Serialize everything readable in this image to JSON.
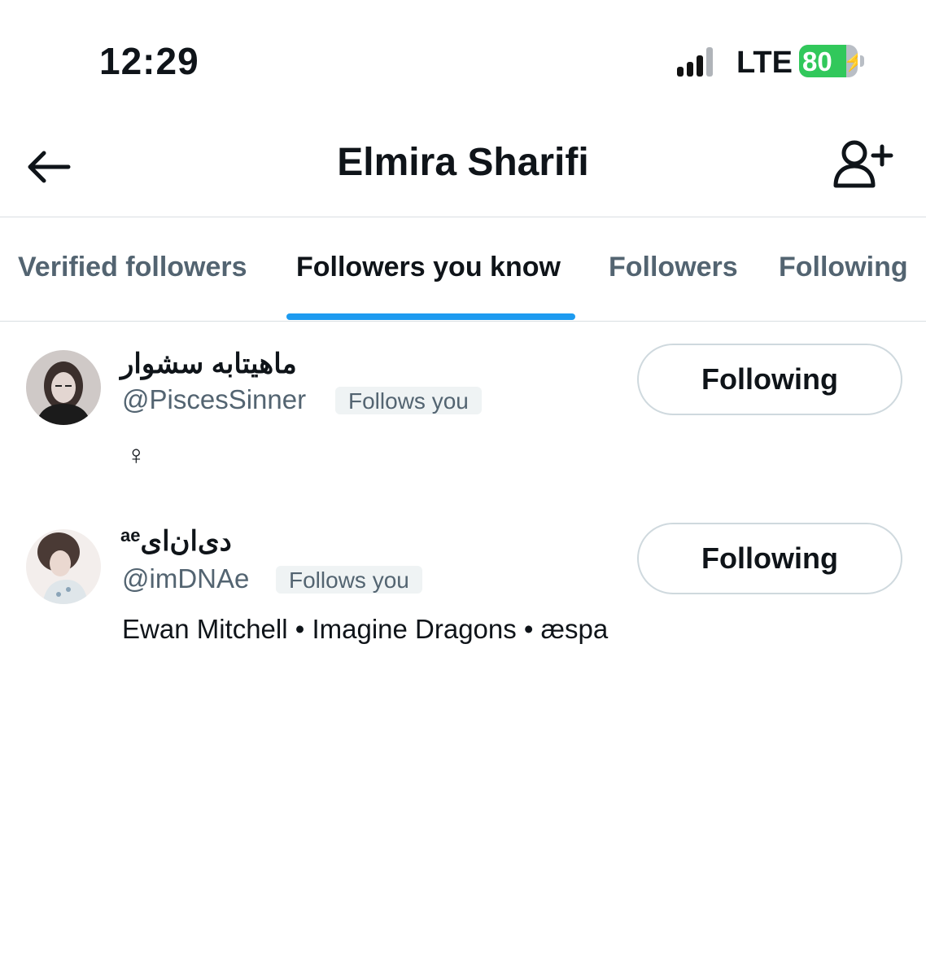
{
  "status_bar": {
    "time": "12:29",
    "network": "LTE",
    "battery": "80",
    "battery_level": 0.8
  },
  "header": {
    "title": "Elmira Sharifi",
    "back_icon": "arrow-left-icon",
    "add_icon": "add-user-icon"
  },
  "tabs": [
    {
      "label": "Verified followers",
      "active": false
    },
    {
      "label": "Followers you know",
      "active": true
    },
    {
      "label": "Followers",
      "active": false
    },
    {
      "label": "Following",
      "active": false
    }
  ],
  "users": [
    {
      "name": "ماهیتابه سشوار",
      "handle": "@PiscesSinner",
      "follows_you": "Follows you",
      "bio": "♀",
      "button": "Following"
    },
    {
      "name": "دی‌ان‌ای",
      "name_suffix": "ae",
      "handle": "@imDNAe",
      "follows_you": "Follows you",
      "bio": "Ewan Mitchell • Imagine Dragons • æspa",
      "button": "Following"
    }
  ]
}
